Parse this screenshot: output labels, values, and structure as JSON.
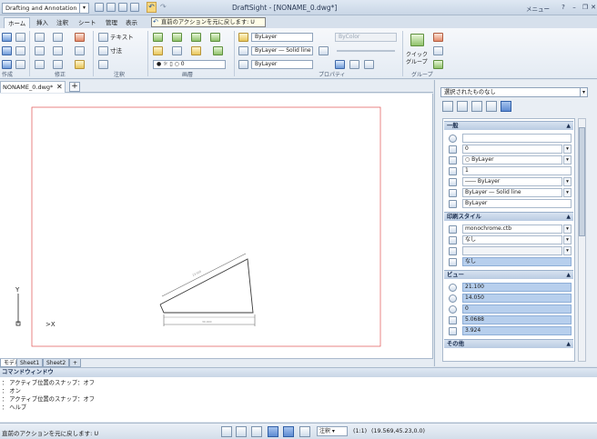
{
  "titlebar": {
    "workspace": "Drafting and Annotation",
    "title": "DraftSight - [NONAME_0.dwg*]",
    "menu_label": "メニュー",
    "tooltip": "直前のアクションを元に戻します: U"
  },
  "ribbon_tabs": [
    "ホーム",
    "挿入",
    "注釈",
    "シート",
    "管理",
    "表示"
  ],
  "ribbon": {
    "group_labels": [
      "作成",
      "修正",
      "注釈",
      "画層",
      "プロパティ",
      "グループ"
    ],
    "annotate": {
      "text": "テキスト",
      "dimension": "寸法"
    },
    "layer_value": "0",
    "props": {
      "color": "ByLayer",
      "linetype": "ByLayer",
      "lineweight": "ByLayer",
      "linestyle_combo": "ByLayer ― Solid line",
      "plotstyle": "ByColor"
    },
    "group": {
      "quick_line1": "クイック",
      "quick_line2": "グループ"
    }
  },
  "document": {
    "tab_label": "NONAME_0.dwg*",
    "close_glyph": "✕",
    "add_glyph": "+"
  },
  "canvas": {
    "dim_top": "23.500",
    "dim_bottom": "30.000",
    "axis_y": "Y",
    "axis_x": ">X"
  },
  "layout_tabs": [
    "モデル",
    "Sheet1",
    "Sheet2",
    "+"
  ],
  "palette": {
    "selector": "選択されたものなし",
    "sections": {
      "general": {
        "title": "一般",
        "rows": [
          "",
          "0",
          "○ ByLayer",
          "1",
          "―― ByLayer",
          "ByLayer ― Solid line",
          "ByLayer"
        ]
      },
      "print": {
        "title": "印刷スタイル",
        "rows": [
          "monochrome.ctb",
          "なし",
          "",
          "なし"
        ]
      },
      "view": {
        "title": "ビュー",
        "rows": [
          "21.100",
          "14.050",
          "0",
          "5.0688",
          "3.924"
        ]
      },
      "other": {
        "title": "その他"
      }
    }
  },
  "command": {
    "title": "コマンドウィンドウ",
    "lines": [
      "： アクティブ位置のスナップ：オフ",
      "： オン",
      "： アクティブ位置のスナップ：オフ",
      "： ヘルプ"
    ]
  },
  "status": {
    "text": "直前のアクションを元に戻します: U",
    "combo": "注釈 ▾",
    "scale": "(1:1)",
    "coords": "(19.569,45.23,0.0)"
  },
  "colors": {
    "accent": "#1d4f9b",
    "frame": "#a9b9cc",
    "print_border": "#e05050",
    "highlight": "#b7cfed"
  }
}
